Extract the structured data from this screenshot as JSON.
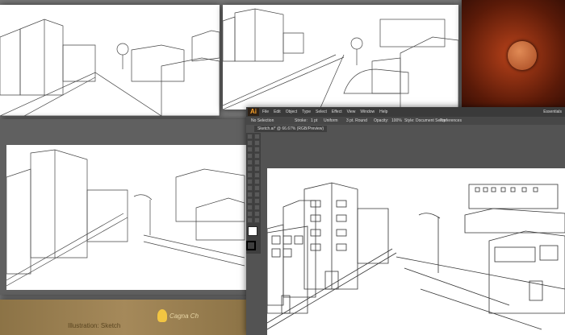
{
  "colors": {
    "desktop": "#7a7a7a",
    "ai_chrome": "#535353",
    "ai_dark": "#3a3a3a",
    "canvas": "#ffffff",
    "ai_orange": "#f7a12a",
    "splash_red": "#8a2a10"
  },
  "top_right": {
    "icon": "adobe-illustrator-splash-icon"
  },
  "illustrator": {
    "logo": "Ai",
    "menu": [
      "File",
      "Edit",
      "Object",
      "Type",
      "Select",
      "Effect",
      "View",
      "Window",
      "Help"
    ],
    "workspace": "Essentials",
    "control": {
      "selection": "No Selection",
      "stroke_label": "Stroke:",
      "stroke_value": "1 pt",
      "style_label": "Uniform",
      "brush": "3 pt. Round",
      "opacity_label": "Opacity:",
      "opacity_value": "100%",
      "style": "Style:",
      "doc_setup": "Document Setup",
      "preferences": "Preferences"
    },
    "tab": "Sketch.ai* @ 66.67% (RGB/Preview)"
  },
  "bottom_left": {
    "caption": "Illustration: Sketch",
    "logo_text": "Cagna Ch"
  }
}
